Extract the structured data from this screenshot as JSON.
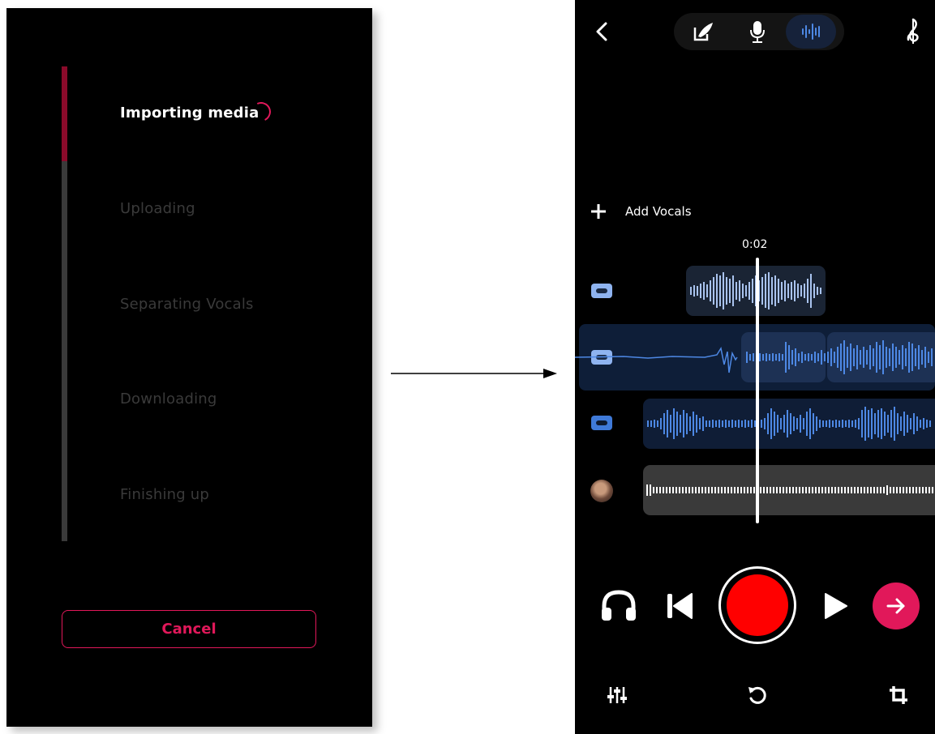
{
  "progress_screen": {
    "steps": [
      {
        "label": "Importing media",
        "active": true
      },
      {
        "label": "Uploading",
        "active": false
      },
      {
        "label": "Separating Vocals",
        "active": false
      },
      {
        "label": "Downloading",
        "active": false
      },
      {
        "label": "Finishing up",
        "active": false
      }
    ],
    "progress_fraction": 0.2,
    "cancel_label": "Cancel"
  },
  "editor_screen": {
    "mode_tabs": [
      "lyrics-icon",
      "microphone-icon",
      "waveform-icon"
    ],
    "active_mode": "waveform-icon",
    "add_vocals_label": "Add Vocals",
    "playhead_time": "0:02",
    "tracks": [
      {
        "icon": "cassette-icon",
        "color": "#8fb4f0"
      },
      {
        "icon": "cassette-icon",
        "color": "#5b8fe0"
      },
      {
        "icon": "cassette-icon",
        "color": "#3f7ad8"
      },
      {
        "icon": "avatar",
        "color": "#888888"
      }
    ],
    "controls": [
      "headphones-icon",
      "skip-back-icon",
      "record-button",
      "play-icon",
      "next-arrow-icon"
    ],
    "bottom_tools": [
      "mixer-icon",
      "undo-icon",
      "crop-icon"
    ]
  },
  "colors": {
    "accent": "#e1185a",
    "record": "#ff0000",
    "wave_light": "#a9c3ee",
    "wave_mid": "#4d88e4"
  }
}
